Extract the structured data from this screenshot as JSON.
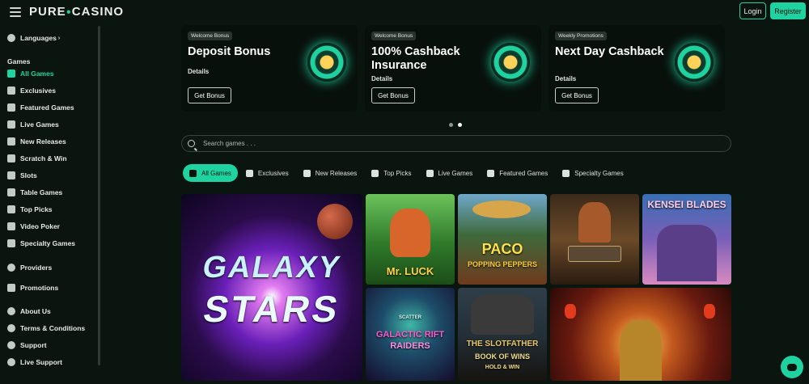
{
  "brand": {
    "name_left": "PURE",
    "name_right": "CASINO"
  },
  "header": {
    "login_label": "Login",
    "register_label": "Register"
  },
  "sidebar": {
    "languages": "Languages",
    "games_heading": "Games",
    "items": [
      {
        "label": "All Games",
        "icon": "horseshoe-icon",
        "active": true
      },
      {
        "label": "Exclusives",
        "icon": "exclusive-icon"
      },
      {
        "label": "Featured Games",
        "icon": "clover-icon"
      },
      {
        "label": "Live Games",
        "icon": "live-icon"
      },
      {
        "label": "New Releases",
        "icon": "new-icon"
      },
      {
        "label": "Scratch & Win",
        "icon": "scratch-icon"
      },
      {
        "label": "Slots",
        "icon": "slots-icon"
      },
      {
        "label": "Table Games",
        "icon": "table-icon"
      },
      {
        "label": "Top Picks",
        "icon": "top-icon"
      },
      {
        "label": "Video Poker",
        "icon": "poker-icon"
      },
      {
        "label": "Specialty Games",
        "icon": "gear-icon"
      }
    ],
    "providers": "Providers",
    "promotions": "Promotions",
    "footer_items": [
      {
        "label": "About Us",
        "icon": "info-icon"
      },
      {
        "label": "Terms & Conditions",
        "icon": "document-icon"
      },
      {
        "label": "Support",
        "icon": "support-icon"
      },
      {
        "label": "Live Support",
        "icon": "chat-icon"
      }
    ]
  },
  "promos": [
    {
      "tag": "Welcome Bonus",
      "title": "Deposit Bonus",
      "details": "Details",
      "cta": "Get Bonus"
    },
    {
      "tag": "Welcome Bonus",
      "title": "100% Cashback Insurance",
      "details": "Details",
      "cta": "Get Bonus"
    },
    {
      "tag": "Weekly Promotions",
      "title": "Next Day Cashback",
      "details": "Details",
      "cta": "Get Bonus"
    }
  ],
  "search": {
    "placeholder": "Search games . . ."
  },
  "tabs": [
    {
      "label": "All Games",
      "active": true
    },
    {
      "label": "Exclusives"
    },
    {
      "label": "New Releases"
    },
    {
      "label": "Top Picks"
    },
    {
      "label": "Live Games"
    },
    {
      "label": "Featured Games"
    },
    {
      "label": "Specialty Games"
    }
  ],
  "games": {
    "galaxy_line1": "GALAXY",
    "galaxy_line2": "STARS",
    "mr_luck": "Mr. LUCK",
    "pado_line1": "PACO",
    "pado_line2": "POPPING PEPPERS",
    "kensei": "KENSEI BLADES",
    "scatter": "SCATTER",
    "galactic_line1": "GALACTIC RIFT",
    "galactic_line2": "RAIDERS",
    "slotfather_line1": "THE SLOTFATHER",
    "slotfather_line2": "BOOK OF WINS",
    "slotfather_line3": "HOLD & WIN"
  },
  "colors": {
    "accent": "#1fd3a0",
    "background": "#0b1510"
  }
}
